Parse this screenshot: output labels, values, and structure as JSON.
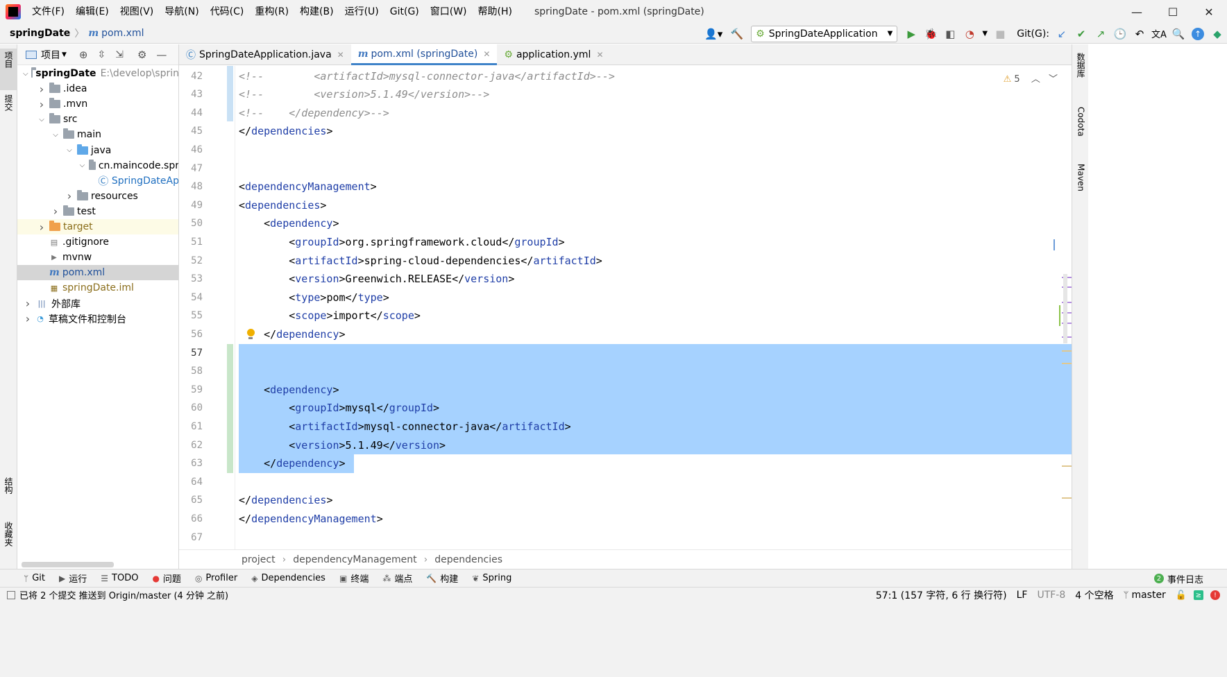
{
  "menu": [
    "文件(F)",
    "编辑(E)",
    "视图(V)",
    "导航(N)",
    "代码(C)",
    "重构(R)",
    "构建(B)",
    "运行(U)",
    "Git(G)",
    "窗口(W)",
    "帮助(H)"
  ],
  "window_title": "springDate - pom.xml (springDate)",
  "breadcrumb": {
    "project": "springDate",
    "file": "pom.xml"
  },
  "toolbar": {
    "run_config": "SpringDateApplication",
    "git_label": "Git(G):"
  },
  "left_strip": {
    "project": "项目",
    "commit": "提交",
    "structure": "结构",
    "favorites": "收藏夹"
  },
  "right_strip": {
    "database": "数据库",
    "codota": "Codota",
    "maven": "Maven"
  },
  "project_panel": {
    "title": "项目",
    "tree": [
      {
        "label": "springDate",
        "path": "E:\\develop\\sprin",
        "indent": 0,
        "expanded": true,
        "icon": "module-folder",
        "bold": true
      },
      {
        "label": ".idea",
        "indent": 1,
        "collapsed": true,
        "icon": "folder"
      },
      {
        "label": ".mvn",
        "indent": 1,
        "collapsed": true,
        "icon": "folder"
      },
      {
        "label": "src",
        "indent": 1,
        "expanded": true,
        "icon": "folder"
      },
      {
        "label": "main",
        "indent": 2,
        "expanded": true,
        "icon": "folder"
      },
      {
        "label": "java",
        "indent": 3,
        "expanded": true,
        "icon": "folder-blue"
      },
      {
        "label": "cn.maincode.spr",
        "indent": 4,
        "expanded": true,
        "icon": "package"
      },
      {
        "label": "SpringDateAp",
        "indent": 5,
        "icon": "spring-class",
        "color": "#1f6fc0"
      },
      {
        "label": "resources",
        "indent": 3,
        "collapsed": true,
        "icon": "folder"
      },
      {
        "label": "test",
        "indent": 2,
        "collapsed": true,
        "icon": "folder"
      },
      {
        "label": "target",
        "indent": 1,
        "collapsed": true,
        "icon": "folder-orange",
        "color": "#8a6d1a",
        "highlight": "#fdfbe6"
      },
      {
        "label": ".gitignore",
        "indent": 1,
        "icon": "file-gitignore"
      },
      {
        "label": "mvnw",
        "indent": 1,
        "icon": "file-script"
      },
      {
        "label": "pom.xml",
        "indent": 1,
        "icon": "maven-file",
        "color": "#1f4f99",
        "selected": true
      },
      {
        "label": "springDate.iml",
        "indent": 1,
        "icon": "iml-file",
        "color": "#8a6d1a"
      },
      {
        "label": "外部库",
        "indent": 0,
        "collapsed": true,
        "icon": "libraries"
      },
      {
        "label": "草稿文件和控制台",
        "indent": 0,
        "collapsed": true,
        "icon": "scratches"
      }
    ]
  },
  "tabs": [
    {
      "label": "SpringDateApplication.java",
      "icon": "spring-class",
      "active": false
    },
    {
      "label": "pom.xml (springDate)",
      "icon": "maven-file",
      "active": true
    },
    {
      "label": "application.yml",
      "icon": "spring-yml",
      "active": false
    }
  ],
  "editor": {
    "warnings": "5",
    "lines": [
      {
        "n": "42",
        "text": "<!--        <artifactId>mysql-connector-java</artifactId>-->",
        "kind": "comment"
      },
      {
        "n": "43",
        "text": "<!--        <version>5.1.49</version>-->",
        "kind": "comment"
      },
      {
        "n": "44",
        "text": "<!--    </dependency>-->",
        "kind": "comment"
      },
      {
        "n": "45",
        "text": "</dependencies>",
        "kind": "xml"
      },
      {
        "n": "46",
        "text": "",
        "kind": "xml"
      },
      {
        "n": "47",
        "text": "",
        "kind": "xml"
      },
      {
        "n": "48",
        "text": "<dependencyManagement>",
        "kind": "xml"
      },
      {
        "n": "49",
        "text": "<dependencies>",
        "kind": "xml"
      },
      {
        "n": "50",
        "text": "    <dependency>",
        "kind": "xml"
      },
      {
        "n": "51",
        "text": "        <groupId>org.springframework.cloud</groupId>",
        "kind": "xml"
      },
      {
        "n": "52",
        "text": "        <artifactId>spring-cloud-dependencies</artifactId>",
        "kind": "xml"
      },
      {
        "n": "53",
        "text": "        <version>Greenwich.RELEASE</version>",
        "kind": "xml"
      },
      {
        "n": "54",
        "text": "        <type>pom</type>",
        "kind": "xml"
      },
      {
        "n": "55",
        "text": "        <scope>import</scope>",
        "kind": "xml"
      },
      {
        "n": "56",
        "text": "    </dependency>",
        "kind": "xml"
      },
      {
        "n": "57",
        "text": "",
        "kind": "xml"
      },
      {
        "n": "58",
        "text": "",
        "kind": "xml"
      },
      {
        "n": "59",
        "text": "    <dependency>",
        "kind": "xml"
      },
      {
        "n": "60",
        "text": "        <groupId>mysql</groupId>",
        "kind": "xml"
      },
      {
        "n": "61",
        "text": "        <artifactId>mysql-connector-java</artifactId>",
        "kind": "xml"
      },
      {
        "n": "62",
        "text": "        <version>5.1.49</version>",
        "kind": "xml"
      },
      {
        "n": "63",
        "text": "    </dependency>",
        "kind": "xml"
      },
      {
        "n": "64",
        "text": "",
        "kind": "xml"
      },
      {
        "n": "65",
        "text": "</dependencies>",
        "kind": "xml"
      },
      {
        "n": "66",
        "text": "</dependencyManagement>",
        "kind": "xml"
      },
      {
        "n": "67",
        "text": "",
        "kind": "xml"
      }
    ]
  },
  "editor_breadcrumb": [
    "project",
    "dependencyManagement",
    "dependencies"
  ],
  "bottom_tabs": [
    {
      "label": "Git",
      "icon": "git-branch-icon"
    },
    {
      "label": "运行",
      "icon": "run-icon"
    },
    {
      "label": "TODO",
      "icon": "todo-icon"
    },
    {
      "label": "问题",
      "icon": "problems-icon"
    },
    {
      "label": "Profiler",
      "icon": "profiler-icon"
    },
    {
      "label": "Dependencies",
      "icon": "dependencies-icon"
    },
    {
      "label": "终端",
      "icon": "terminal-icon"
    },
    {
      "label": "端点",
      "icon": "endpoints-icon"
    },
    {
      "label": "构建",
      "icon": "build-icon"
    },
    {
      "label": "Spring",
      "icon": "spring-icon"
    }
  ],
  "event_log": {
    "count": "2",
    "label": "事件日志"
  },
  "status": {
    "message": "已将 2 个提交 推送到 Origin/master (4 分钟 之前)",
    "position": "57:1 (157 字符, 6 行 换行符)",
    "line_sep": "LF",
    "encoding": "UTF-8",
    "indent": "4 个空格",
    "branch": "master"
  },
  "colors": {
    "accent": "#4083c9",
    "selection": "#a6d2ff",
    "xml_tag": "#1f3ea7",
    "comment": "#8c8c8c"
  }
}
